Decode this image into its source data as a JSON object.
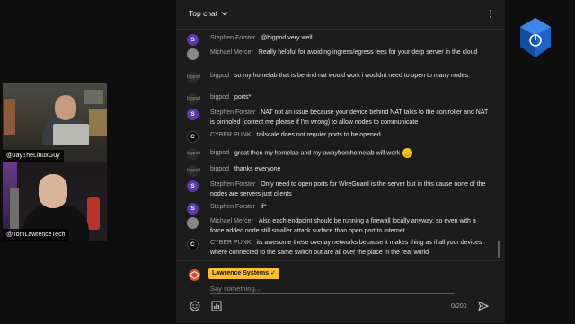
{
  "cams": [
    {
      "handle": "@JayTheLinuxGuy"
    },
    {
      "handle": "@TomLawrenceTech"
    }
  ],
  "chat": {
    "header": {
      "title": "Top chat",
      "chevron_icon": "chevron-down-icon",
      "menu_icon": "kebab-menu-icon"
    },
    "messages": [
      {
        "author": "Stephen Forster",
        "avatar": "S",
        "text": "@bigpod very well"
      },
      {
        "author": "Michael Mercer",
        "avatar": "",
        "text": "Really helpful for avoiding ingress/egress fees for your derp server in the cloud"
      },
      {
        "author": "bigpod",
        "avatar": "bigpod",
        "text": "so my homelab that is behind nat would work i wouldnt need to open to many nodes"
      },
      {
        "author": "bigpod",
        "avatar": "bigpod",
        "text": "ports*"
      },
      {
        "author": "Stephen Forster",
        "avatar": "S",
        "text": "NAT not an issue because your device behind NAT talks to the controller and NAT is pinholed (correct me please if I'm wrong) to allow nodes to communicate"
      },
      {
        "author": "CYBER PUNK",
        "avatar": "C",
        "text": "tailscale does not requier ports to be opened"
      },
      {
        "author": "bigpod",
        "avatar": "bigpod",
        "text": "great then my homelab and my awayfromhomelab will work",
        "emoji": "slightly-smiling-face-icon"
      },
      {
        "author": "bigpod",
        "avatar": "bigpod",
        "text": "thanks everyone"
      },
      {
        "author": "Stephen Forster",
        "avatar": "S",
        "text": "Only need to open ports for WireGuard is the server but in this cause none of the nodes are servers just clients"
      },
      {
        "author": "Stephen Forster",
        "avatar": "S",
        "text": "if*"
      },
      {
        "author": "Michael Mercer",
        "avatar": "",
        "text": "Also each endpoint should be running a firewall locally anyway, so even with a force added node still smaller attack surface than open port to internet"
      },
      {
        "author": "CYBER PUNK",
        "avatar": "C",
        "text": "its awesome these overlay networks because it makes thing as if all your devices where connected to the same switch but are all over the place in the real world"
      }
    ],
    "composer": {
      "user_name": "Lawrence Systems",
      "verified_icon": "checkmark-icon",
      "placeholder": "Say something...",
      "counter": "0/200",
      "emoji_icon": "emoji-icon",
      "poll_icon": "poll-icon",
      "send_icon": "send-icon"
    }
  },
  "colors": {
    "panel_bg": "#1c1c1c",
    "stephen_avatar": "#5c3aa8",
    "badge_bg": "#fbc02d",
    "channel_avatar": "#d94f2b",
    "logo_blue": "#1e63c9"
  }
}
